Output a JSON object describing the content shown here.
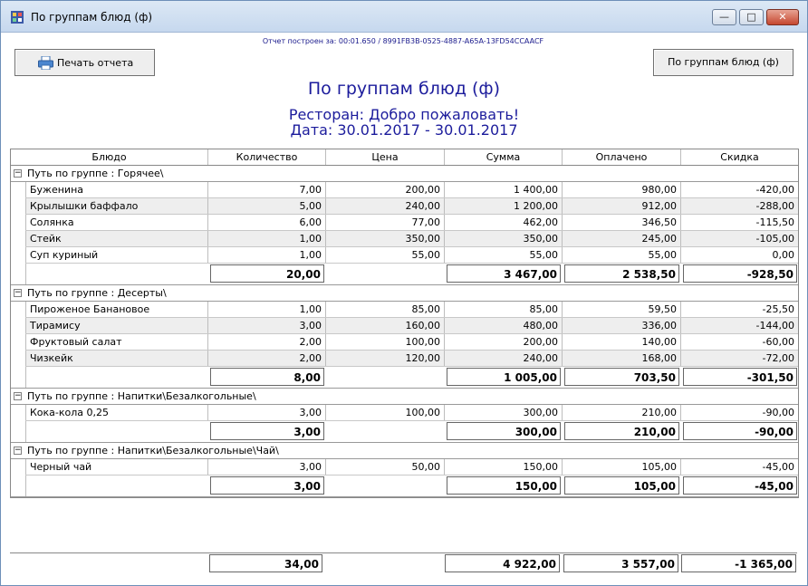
{
  "window": {
    "title": "По группам блюд (ф)"
  },
  "meta": "Отчет построен за: 00:01.650 / 8991FB3B-0525-4887-A65A-13FD54CCAACF",
  "toolbar": {
    "print_label": "Печать отчета",
    "group_label": "По группам блюд (ф)"
  },
  "report": {
    "title": "По группам блюд (ф)",
    "restaurant": "Ресторан: Добро пожаловать!",
    "date": "Дата: 30.01.2017 - 30.01.2017"
  },
  "columns": [
    "Блюдо",
    "Количество",
    "Цена",
    "Сумма",
    "Оплачено",
    "Скидка"
  ],
  "groups": [
    {
      "label": "Путь по группе : Горячее\\",
      "rows": [
        [
          "Буженина",
          "7,00",
          "200,00",
          "1 400,00",
          "980,00",
          "-420,00"
        ],
        [
          "Крылышки баффало",
          "5,00",
          "240,00",
          "1 200,00",
          "912,00",
          "-288,00"
        ],
        [
          "Солянка",
          "6,00",
          "77,00",
          "462,00",
          "346,50",
          "-115,50"
        ],
        [
          "Стейк",
          "1,00",
          "350,00",
          "350,00",
          "245,00",
          "-105,00"
        ],
        [
          "Суп куриный",
          "1,00",
          "55,00",
          "55,00",
          "55,00",
          "0,00"
        ]
      ],
      "total": {
        "qty": "20,00",
        "sum": "3 467,00",
        "paid": "2 538,50",
        "disc": "-928,50"
      }
    },
    {
      "label": "Путь по группе : Десерты\\",
      "rows": [
        [
          "Пироженое Банановое",
          "1,00",
          "85,00",
          "85,00",
          "59,50",
          "-25,50"
        ],
        [
          "Тирамису",
          "3,00",
          "160,00",
          "480,00",
          "336,00",
          "-144,00"
        ],
        [
          "Фруктовый салат",
          "2,00",
          "100,00",
          "200,00",
          "140,00",
          "-60,00"
        ],
        [
          "Чизкейк",
          "2,00",
          "120,00",
          "240,00",
          "168,00",
          "-72,00"
        ]
      ],
      "total": {
        "qty": "8,00",
        "sum": "1 005,00",
        "paid": "703,50",
        "disc": "-301,50"
      }
    },
    {
      "label": "Путь по группе : Напитки\\Безалкогольные\\",
      "rows": [
        [
          "Кока-кола 0,25",
          "3,00",
          "100,00",
          "300,00",
          "210,00",
          "-90,00"
        ]
      ],
      "total": {
        "qty": "3,00",
        "sum": "300,00",
        "paid": "210,00",
        "disc": "-90,00"
      }
    },
    {
      "label": "Путь по группе : Напитки\\Безалкогольные\\Чай\\",
      "rows": [
        [
          "Черный чай",
          "3,00",
          "50,00",
          "150,00",
          "105,00",
          "-45,00"
        ]
      ],
      "total": {
        "qty": "3,00",
        "sum": "150,00",
        "paid": "105,00",
        "disc": "-45,00"
      }
    }
  ],
  "grand_total": {
    "qty": "34,00",
    "sum": "4 922,00",
    "paid": "3 557,00",
    "disc": "-1 365,00"
  },
  "colors": {
    "accent": "#1c1c9c",
    "titlebar": "#c6d8ee"
  }
}
